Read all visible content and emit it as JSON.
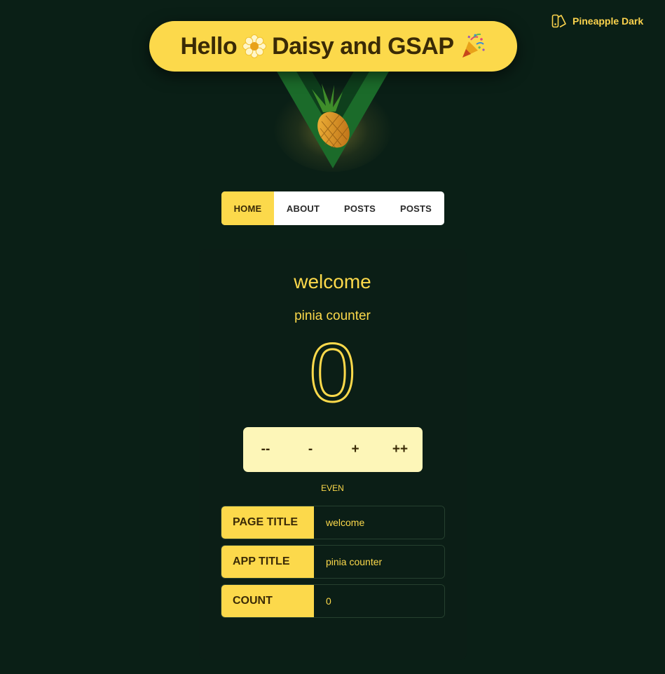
{
  "theme": {
    "label": "Pineapple Dark",
    "icon": "palette-swatch-icon"
  },
  "hero": {
    "text_before": "Hello",
    "emoji_flower": "🌼",
    "text_middle": "Daisy and GSAP",
    "emoji_party": "🎉"
  },
  "logo": {
    "icon": "vue-logo-with-pineapple-icon"
  },
  "nav": {
    "items": [
      {
        "label": "Home",
        "active": true
      },
      {
        "label": "About",
        "active": false
      },
      {
        "label": "Posts",
        "active": false
      },
      {
        "label": "Posts",
        "active": false
      }
    ]
  },
  "main": {
    "page_title": "welcome",
    "app_title": "pinia counter",
    "count": "0",
    "counter_buttons": [
      "--",
      "-",
      "+",
      "++"
    ],
    "parity": "even"
  },
  "info": {
    "rows": [
      {
        "label": "Page Title",
        "value": "welcome"
      },
      {
        "label": "App Title",
        "value": "pinia counter"
      },
      {
        "label": "Count",
        "value": "0"
      }
    ]
  },
  "colors": {
    "background": "#0a1f16",
    "accent": "#fcd94b",
    "accent_light": "#fdf6b8",
    "vue_green": "#1f7a2e"
  }
}
